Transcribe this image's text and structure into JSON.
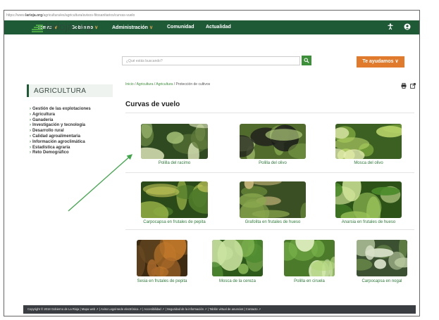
{
  "browser": {
    "url_prefix": "https://www.",
    "url_domain": "larioja.org",
    "url_path": "/agricultura/es/agricultura/avisos-fitosanitarios/curvas-vuelo"
  },
  "topnav": {
    "items": [
      {
        "label": "Temas",
        "dropdown": true
      },
      {
        "label": "Gobierno",
        "dropdown": true
      },
      {
        "label": "Administración",
        "dropdown": true
      },
      {
        "label": "Comunidad",
        "dropdown": false
      },
      {
        "label": "Actualidad",
        "dropdown": false
      }
    ],
    "accessibility_icon": "accessibility-icon",
    "user_icon": "user-icon"
  },
  "header": {
    "logo_text": "larioja.org",
    "search_placeholder": "¿Qué estás buscando?",
    "search_icon": "search-icon",
    "help_label": "Te ayudamos"
  },
  "sidebar": {
    "section_title": "AGRICULTURA",
    "items": [
      "Gestión de las explotaciones",
      "Agricultura",
      "Ganadería",
      "Investigación y tecnología",
      "Desarrollo rural",
      "Calidad agroalimentaria",
      "Información agroclimática",
      "Estadística agraria",
      "Reto Demográfico"
    ]
  },
  "breadcrumb": {
    "items": [
      "Inicio",
      "Agricultura",
      "Agricultura"
    ],
    "current": "Protección de cultivos",
    "separator": "/"
  },
  "page_tools": {
    "print_icon": "print-icon",
    "share_icon": "share-icon"
  },
  "main": {
    "title": "Curvas de vuelo",
    "cards": [
      {
        "caption": "Polilla del racimo"
      },
      {
        "caption": "Polilla del olivo"
      },
      {
        "caption": "Mosca del olivo"
      },
      {
        "caption": "Carpocapsa en frutales de pepita"
      },
      {
        "caption": "Grafolita en frutales de hueso"
      },
      {
        "caption": "Anarsia en frutales de hueso"
      },
      {
        "caption": "Sesia en frutales de pepita"
      },
      {
        "caption": "Mosca de la cereza"
      },
      {
        "caption": "Polilla en ciruela"
      },
      {
        "caption": "Carpocapsa en nogal"
      }
    ]
  },
  "footer": {
    "text": "Copyright © 2018 Gobierno de La Rioja | Mapa web ↗ | Aviso Legal-sede electrónica ↗ | Accesibilidad ↗ | Seguridad de la información ↗ | Tablón virtual de anuncios | Contacto ↗"
  },
  "colors": {
    "nav_green": "#1f5a37",
    "link_green": "#2f7a3a",
    "accent_orange": "#e07a2c",
    "annotation_arrow": "#3fa64a"
  }
}
